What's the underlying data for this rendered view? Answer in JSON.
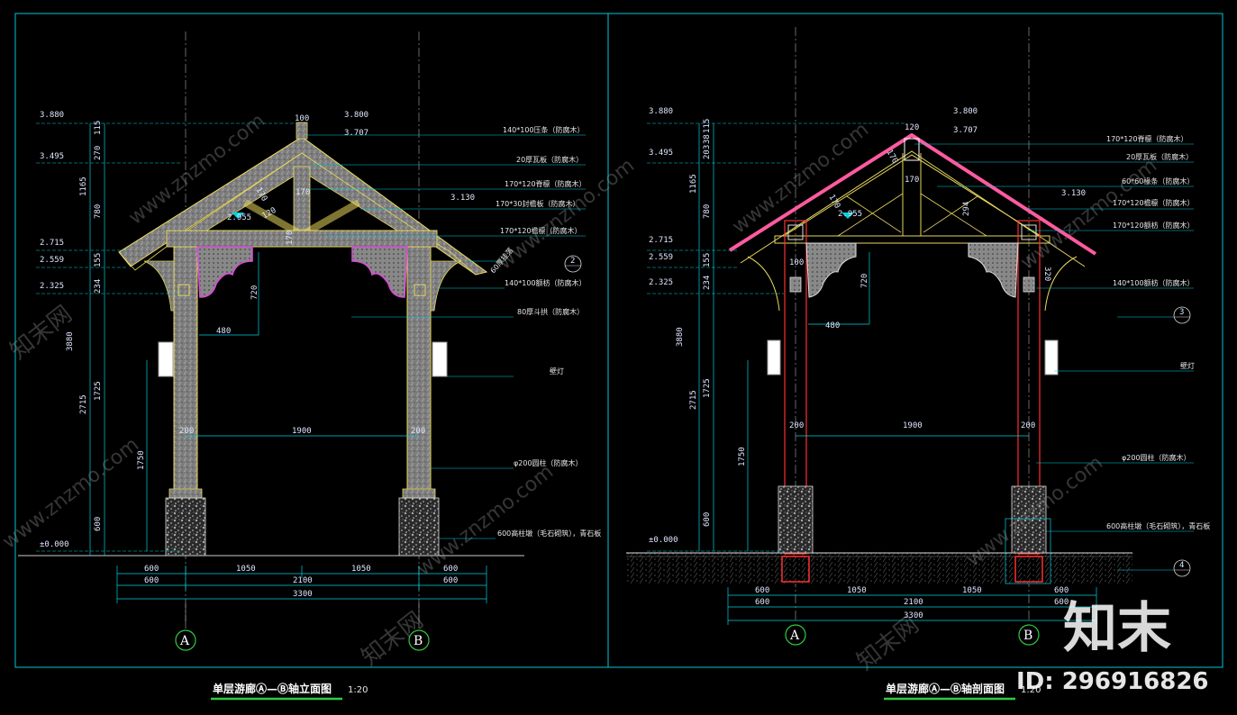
{
  "drawings": [
    {
      "title": "单层游廊Ⓐ—Ⓑ轴立面图",
      "scale": "1:20",
      "levels": [
        "3.880",
        "3.495",
        "2.715",
        "2.559",
        "2.325",
        "±0.000"
      ],
      "ridge_levels": [
        "3.800",
        "3.707",
        "3.130",
        "2.955"
      ],
      "vertical_dims_outer": [
        "115",
        "270",
        "780",
        "155",
        "234",
        "3880",
        "2715",
        "1725",
        "1750",
        "600",
        "1165"
      ],
      "top_width": "100",
      "callouts": [
        "140*100压条（防腐木）",
        "20厚瓦板（防腐木）",
        "170*120脊檩（防腐木）",
        "170*30封檐板（防腐木）",
        "170*120檐檩（防腐木）",
        "60厚挂落",
        "140*100额枋（防腐木）",
        "80厚斗拱（防腐木）",
        "壁灯",
        "φ200圆柱（防腐木）",
        "600高柱墩（毛石砌筑），青石板"
      ],
      "inner_dims": [
        "170",
        "120",
        "170",
        "170",
        "720",
        "480",
        "1900",
        "200",
        "200"
      ],
      "detail_ref": "2",
      "bottom_dims": {
        "row1": [
          "600",
          "1050",
          "1050",
          "600"
        ],
        "row2": [
          "600",
          "2100",
          "600"
        ],
        "row3": [
          "3300"
        ]
      },
      "axes": [
        "A",
        "B"
      ]
    },
    {
      "title": "单层游廊Ⓐ—Ⓑ轴剖面图",
      "scale": "1:20",
      "levels": [
        "3.880",
        "3.495",
        "2.715",
        "2.559",
        "2.325",
        "±0.000"
      ],
      "ridge_levels": [
        "3.800",
        "3.707",
        "3.130",
        "2.955"
      ],
      "vertical_dims_outer": [
        "115",
        "203",
        "780",
        "155",
        "234",
        "3880",
        "2715",
        "1725",
        "1750",
        "600",
        "1165",
        "38"
      ],
      "top_width": "120",
      "callouts": [
        "170*120脊檩（防腐木）",
        "20厚瓦板（防腐木）",
        "60*60椽条（防腐木）",
        "170*120檐檩（防腐木）",
        "170*120额枋（防腐木）",
        "140*100额枋（防腐木）",
        "壁灯",
        "φ200圆柱（防腐木）",
        "600高柱墩（毛石砌筑），青石板"
      ],
      "inner_dims": [
        "170",
        "170",
        "170",
        "294",
        "100",
        "720",
        "480",
        "1900",
        "200",
        "200",
        "320"
      ],
      "detail_refs": [
        "3",
        "4"
      ],
      "bottom_dims": {
        "row1": [
          "600",
          "1050",
          "1050",
          "600"
        ],
        "row2": [
          "600",
          "2100",
          "600"
        ],
        "row3": [
          "3300"
        ]
      },
      "axes": [
        "A",
        "B"
      ]
    }
  ],
  "watermark": {
    "brand": "知末",
    "id": "ID: 296916826",
    "site": "www.znzmo.com",
    "cn_site": "知末网"
  },
  "colors": {
    "background": "#000000",
    "frame": "#00c8d8",
    "dimension": "#00d0e0",
    "timber": "#e8d65c",
    "ornament": "#d94ad9",
    "section_red": "#ff3030",
    "roof_pink": "#ff5aa0",
    "axis_circle": "#2ecc40",
    "title_underline": "#2ecc40"
  }
}
